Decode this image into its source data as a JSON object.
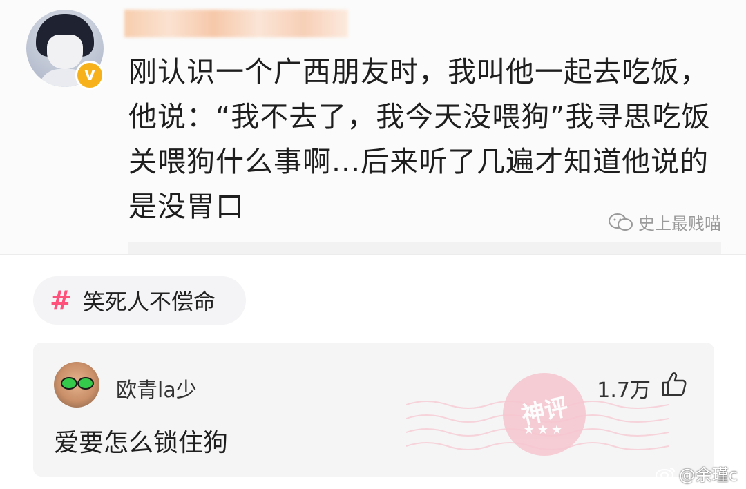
{
  "post": {
    "text": "刚认识一个广西朋友时，我叫他一起去吃饭，他说：“我不去了，我今天没喂狗”我寻思吃饭关喂狗什么事啊...后来听了几遍才知道他说的是没胃口",
    "verify_badge": "V",
    "source_watermark": "史上最贱喵"
  },
  "topic": {
    "hash": "#",
    "label": "笑死人不偿命"
  },
  "comment": {
    "username": "欧青la少",
    "likes": "1.7万",
    "text": "爱要怎么锁住狗",
    "badge_text": "神评",
    "badge_stars": "★★★"
  },
  "weibo_watermark": "@余瑾c",
  "colors": {
    "accent_pink": "#ff4f7b",
    "verify_gold": "#f7b21b",
    "stamp_pink": "#f6c6cf"
  },
  "icons": [
    "wechat-icon",
    "hash-icon",
    "like-icon",
    "weibo-icon"
  ]
}
